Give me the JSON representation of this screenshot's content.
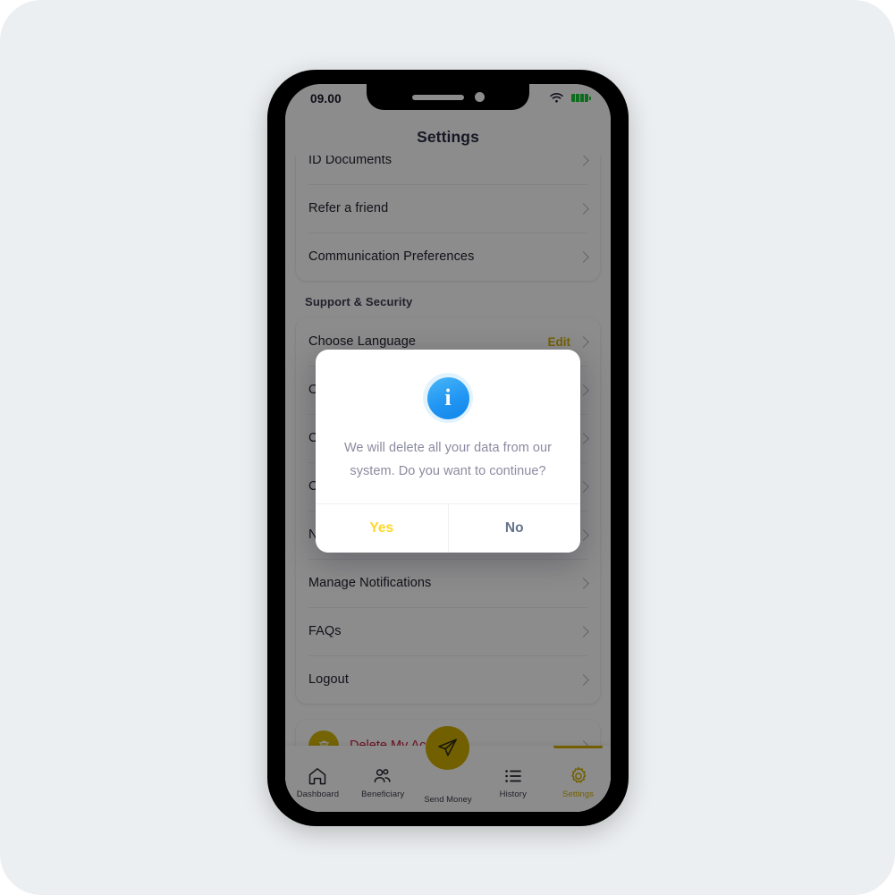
{
  "status_bar": {
    "time": "09.00",
    "wifi_icon": "wifi-icon",
    "battery_icon": "battery-full-icon"
  },
  "header": {
    "title": "Settings"
  },
  "content": {
    "account_rows": [
      {
        "label": "ID Documents",
        "action": ""
      },
      {
        "label": "Refer a friend",
        "action": ""
      },
      {
        "label": "Communication Preferences",
        "action": ""
      }
    ],
    "section_header": "Support & Security",
    "support_rows": [
      {
        "label": "Choose Language",
        "action": "Edit"
      },
      {
        "label": "Our Rates",
        "action": ""
      },
      {
        "label": "Contact Us",
        "action": ""
      },
      {
        "label": "Company Details",
        "action": ""
      },
      {
        "label": "Notifications",
        "action": ""
      },
      {
        "label": "Manage Notifications",
        "action": ""
      },
      {
        "label": "FAQs",
        "action": ""
      },
      {
        "label": "Logout",
        "action": ""
      }
    ],
    "delete_account": {
      "label": "Delete My Account",
      "icon": "trash-icon"
    }
  },
  "bottom_nav": {
    "items": [
      {
        "label": "Dashboard",
        "icon": "home-icon",
        "active": false
      },
      {
        "label": "Beneficiary",
        "icon": "people-icon",
        "active": false
      },
      {
        "label": "Send Money",
        "icon": "paper-plane-icon",
        "active": false
      },
      {
        "label": "History",
        "icon": "list-icon",
        "active": false
      },
      {
        "label": "Settings",
        "icon": "gear-icon",
        "active": true
      }
    ]
  },
  "dialog": {
    "icon": "info-icon",
    "icon_glyph": "i",
    "message": "We will delete all your data from our system. Do you want to continue?",
    "yes_label": "Yes",
    "no_label": "No"
  },
  "colors": {
    "brand_yellow": "#cfae00",
    "dialog_yes": "#ffd727",
    "dialog_no": "#64748b",
    "danger_red": "#c41e3a",
    "info_blue": "#2196f3"
  }
}
